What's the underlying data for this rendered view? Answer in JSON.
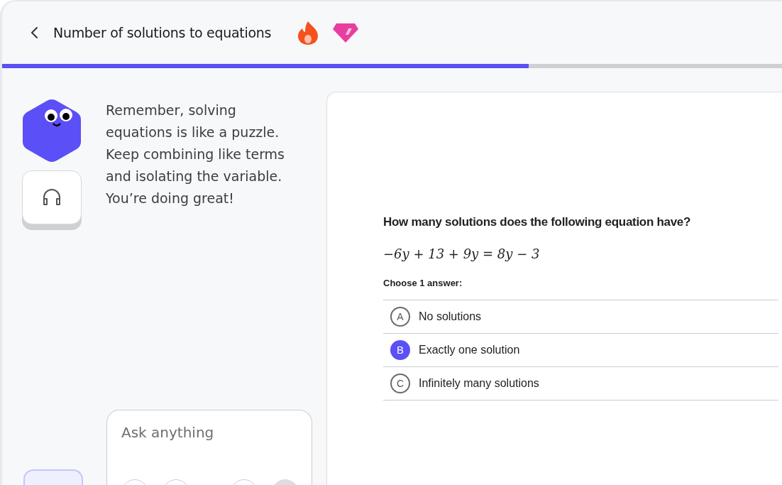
{
  "header": {
    "title": "Number of solutions to equations"
  },
  "progress": {
    "level": 0.675
  },
  "tutor": {
    "message": "Remember, solving equations is like a puzzle. Keep combining like terms and isolating the variable. You’re doing great!"
  },
  "chat": {
    "placeholder": "Ask anything"
  },
  "question": {
    "prompt": "How many solutions does the following equation have?",
    "equation": "−6y + 13 + 9y = 8y − 3",
    "instruction": "Choose 1 answer:",
    "choices": [
      {
        "letter": "A",
        "text": "No solutions",
        "selected": false
      },
      {
        "letter": "B",
        "text": "Exactly one solution",
        "selected": true
      },
      {
        "letter": "C",
        "text": "Infinitely many solutions",
        "selected": false
      }
    ]
  }
}
